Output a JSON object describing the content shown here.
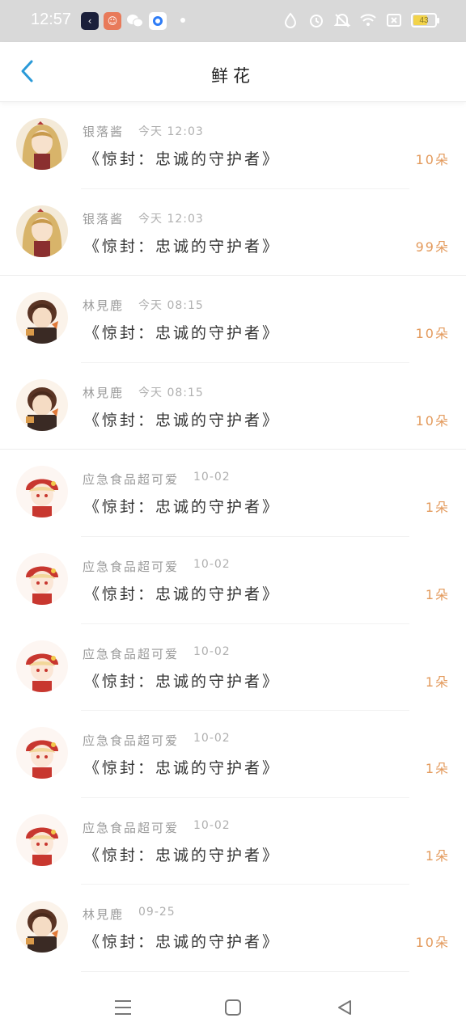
{
  "status_bar": {
    "time": "12:57",
    "battery": "43",
    "apps": [
      "app-icon-dark",
      "app-icon-avatar",
      "wechat-icon",
      "browser-icon"
    ]
  },
  "header": {
    "title": "鲜花"
  },
  "rows": [
    {
      "name": "银落酱",
      "time": "今天 12:03",
      "book": "《惊封：忠诚的守护者》",
      "count": "10朵",
      "avatar": "blonde"
    },
    {
      "name": "银落酱",
      "time": "今天 12:03",
      "book": "《惊封：忠诚的守护者》",
      "count": "99朵",
      "avatar": "blonde"
    },
    {
      "name": "林見鹿",
      "time": "今天 08:15",
      "book": "《惊封：忠诚的守护者》",
      "count": "10朵",
      "avatar": "brown"
    },
    {
      "name": "林見鹿",
      "time": "今天 08:15",
      "book": "《惊封：忠诚的守护者》",
      "count": "10朵",
      "avatar": "brown"
    },
    {
      "name": "应急食品超可爱",
      "time": "10-02",
      "book": "《惊封：忠诚的守护者》",
      "count": "1朵",
      "avatar": "red"
    },
    {
      "name": "应急食品超可爱",
      "time": "10-02",
      "book": "《惊封：忠诚的守护者》",
      "count": "1朵",
      "avatar": "red"
    },
    {
      "name": "应急食品超可爱",
      "time": "10-02",
      "book": "《惊封：忠诚的守护者》",
      "count": "1朵",
      "avatar": "red"
    },
    {
      "name": "应急食品超可爱",
      "time": "10-02",
      "book": "《惊封：忠诚的守护者》",
      "count": "1朵",
      "avatar": "red"
    },
    {
      "name": "应急食品超可爱",
      "time": "10-02",
      "book": "《惊封：忠诚的守护者》",
      "count": "1朵",
      "avatar": "red"
    },
    {
      "name": "林見鹿",
      "time": "09-25",
      "book": "《惊封：忠诚的守护者》",
      "count": "10朵",
      "avatar": "brown"
    }
  ],
  "colors": {
    "accent_blue": "#2a9ad8",
    "count_orange": "#e39a5c",
    "status_bar_bg": "#d9d9d9"
  }
}
